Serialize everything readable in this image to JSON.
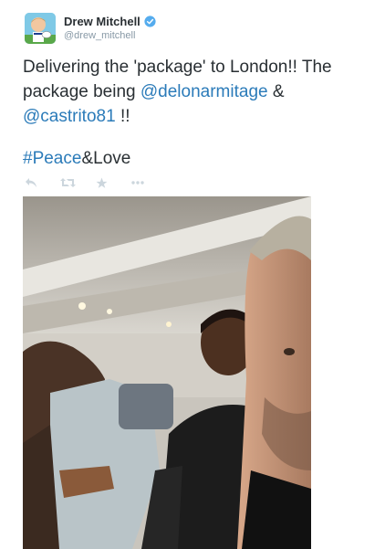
{
  "user": {
    "name": "Drew Mitchell",
    "handle": "@drew_mitchell",
    "avatar_icon": "cartoon-avatar-icon",
    "verified_icon": "verified-badge-icon"
  },
  "tweet": {
    "part1": "Delivering the 'package' to London!! The package being ",
    "mention1": "@delonarmitage",
    "part2": " & ",
    "mention2": "@castrito81",
    "part3": " !!",
    "hashtag": "#Peace",
    "hash_tail": "&Love"
  },
  "actions": [
    {
      "icon": "reply-icon"
    },
    {
      "icon": "retweet-icon"
    },
    {
      "icon": "favorite-star-icon"
    },
    {
      "icon": "more-icon"
    }
  ],
  "colors": {
    "link": "#2b7bb9",
    "text": "#292f33",
    "muted": "#8899a6",
    "verified": "#55acee",
    "icons": "#ccd6dd"
  },
  "photo": {
    "subject": "airplane-cabin-selfie-image"
  }
}
